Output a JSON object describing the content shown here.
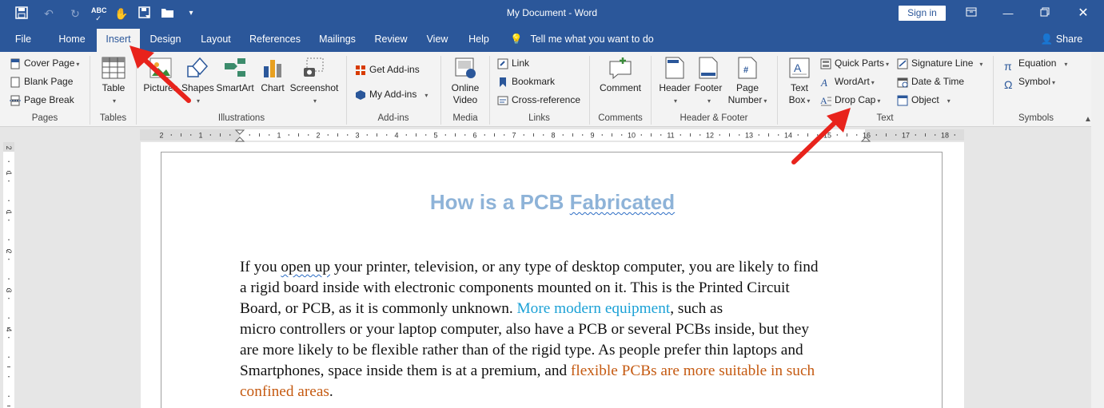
{
  "app": {
    "document_title": "My Document  -  Word",
    "sign_in_label": "Sign in"
  },
  "tabs": [
    {
      "label": "File"
    },
    {
      "label": "Home"
    },
    {
      "label": "Insert"
    },
    {
      "label": "Design"
    },
    {
      "label": "Layout"
    },
    {
      "label": "References"
    },
    {
      "label": "Mailings"
    },
    {
      "label": "Review"
    },
    {
      "label": "View"
    },
    {
      "label": "Help"
    }
  ],
  "active_tab": "Insert",
  "tell_me": "Tell me what you want to do",
  "share_label": "Share",
  "ribbon": {
    "pages": {
      "label": "Pages",
      "cover_page": "Cover Page",
      "blank_page": "Blank Page",
      "page_break": "Page Break"
    },
    "tables": {
      "label": "Tables",
      "table": "Table"
    },
    "illustrations": {
      "label": "Illustrations",
      "pictures": "Pictures",
      "shapes": "Shapes",
      "smartart": "SmartArt",
      "chart": "Chart",
      "screenshot": "Screenshot"
    },
    "addins": {
      "label": "Add-ins",
      "get_addins": "Get Add-ins",
      "my_addins": "My Add-ins"
    },
    "media": {
      "label": "Media",
      "online_video_1": "Online",
      "online_video_2": "Video"
    },
    "links": {
      "label": "Links",
      "link": "Link",
      "bookmark": "Bookmark",
      "cross_reference": "Cross-reference"
    },
    "comments": {
      "label": "Comments",
      "comment": "Comment"
    },
    "header_footer": {
      "label": "Header & Footer",
      "header": "Header",
      "footer": "Footer",
      "page_number_1": "Page",
      "page_number_2": "Number"
    },
    "text": {
      "label": "Text",
      "text_box_1": "Text",
      "text_box_2": "Box",
      "quick_parts": "Quick Parts",
      "wordart": "WordArt",
      "drop_cap": "Drop Cap",
      "signature_line": "Signature Line",
      "date_time": "Date & Time",
      "object": "Object"
    },
    "symbols": {
      "label": "Symbols",
      "equation": "Equation",
      "symbol": "Symbol"
    }
  },
  "ruler": {
    "numbers": [
      "2",
      "1",
      "1",
      "2",
      "3",
      "4",
      "5",
      "6",
      "7",
      "8",
      "9",
      "10",
      "11",
      "12",
      "13",
      "14",
      "15",
      "16",
      "17",
      "18"
    ],
    "vnumbers": [
      "2",
      "1",
      "1",
      "2",
      "3",
      "4"
    ]
  },
  "document": {
    "heading_part1": "How is a PCB ",
    "heading_part2": "Fabricated",
    "p_line1a": "If you ",
    "p_line1b": "open up",
    "p_line1c": " your printer, television, or any type of desktop computer, you are likely to find",
    "p_line2": "a rigid board inside with electronic components mounted on it. This is the Printed Circuit",
    "p_line3a": "Board, or PCB, as it is commonly unknown. ",
    "p_line3b": "More modern equipment",
    "p_line3c": ", such as",
    "p_line4": "micro controllers or your laptop computer, also have a PCB or several PCBs inside, but they",
    "p_line5": "are more likely to be flexible rather than of the rigid type. As people prefer thin laptops and",
    "p_line6a": "Smartphones, space inside them is at a premium, and ",
    "p_line6b": "flexible PCBs are more suitable in such",
    "p_line7a": "confined areas",
    "p_line7b": "."
  },
  "colors": {
    "accent": "#2b579a",
    "heading": "#8eb3d8",
    "link": "#1ba1d6",
    "orange": "#c55a11",
    "arrow": "#e8231c"
  }
}
